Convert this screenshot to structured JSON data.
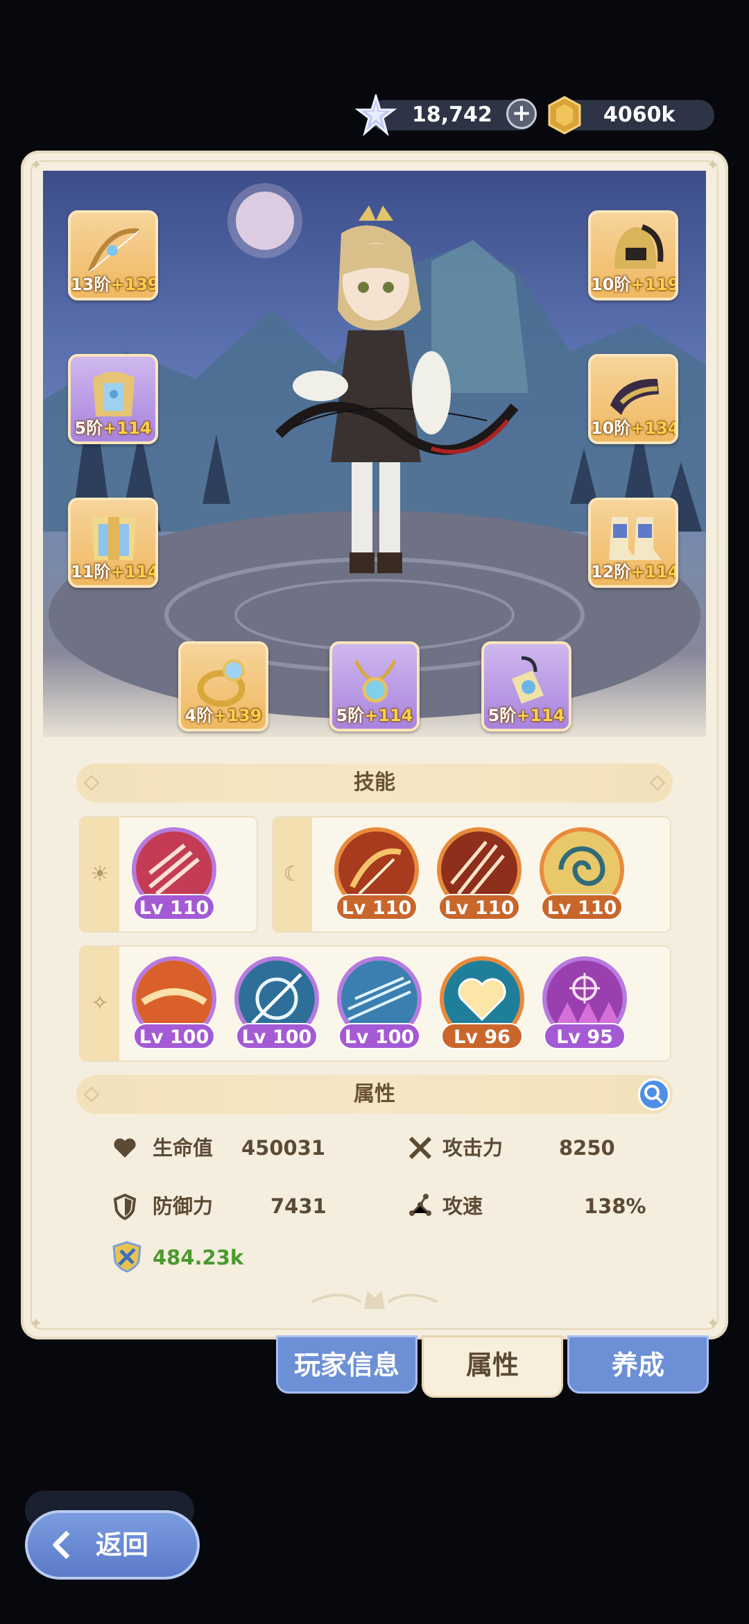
{
  "currency": {
    "gems": "18,742",
    "gold": "4060k"
  },
  "equipment": [
    {
      "slot": "bow",
      "tier": "13阶",
      "bonus": "+139",
      "rarity": "orange"
    },
    {
      "slot": "helmet",
      "tier": "10阶",
      "bonus": "+119",
      "rarity": "orange"
    },
    {
      "slot": "armor",
      "tier": "5阶",
      "bonus": "+114",
      "rarity": "purple"
    },
    {
      "slot": "gloves",
      "tier": "10阶",
      "bonus": "+134",
      "rarity": "orange"
    },
    {
      "slot": "belt",
      "tier": "11阶",
      "bonus": "+114",
      "rarity": "orange"
    },
    {
      "slot": "boots",
      "tier": "12阶",
      "bonus": "+114",
      "rarity": "orange"
    },
    {
      "slot": "ring",
      "tier": "4阶",
      "bonus": "+139",
      "rarity": "orange"
    },
    {
      "slot": "necklace",
      "tier": "5阶",
      "bonus": "+114",
      "rarity": "purple"
    },
    {
      "slot": "amulet",
      "tier": "5阶",
      "bonus": "+114",
      "rarity": "purple"
    }
  ],
  "skills": {
    "title": "技能",
    "day": [
      {
        "level": "Lv 110",
        "rarity": "purple"
      }
    ],
    "night": [
      {
        "level": "Lv 110",
        "rarity": "orange"
      },
      {
        "level": "Lv 110",
        "rarity": "orange"
      },
      {
        "level": "Lv 110",
        "rarity": "orange"
      }
    ],
    "star": [
      {
        "level": "Lv 100",
        "rarity": "purple"
      },
      {
        "level": "Lv 100",
        "rarity": "purple"
      },
      {
        "level": "Lv 100",
        "rarity": "purple"
      },
      {
        "level": "Lv 96",
        "rarity": "orange"
      },
      {
        "level": "Lv 95",
        "rarity": "purple"
      }
    ]
  },
  "attributes": {
    "title": "属性",
    "hp_label": "生命值",
    "hp_value": "450031",
    "atk_label": "攻击力",
    "atk_value": "8250",
    "def_label": "防御力",
    "def_value": "7431",
    "spd_label": "攻速",
    "spd_value": "138%",
    "power_value": "484.23k"
  },
  "tabs": [
    "玩家信息",
    "属性",
    "养成"
  ],
  "back_label": "返回",
  "colors": {
    "panel": "#f5eedf",
    "tab_blue": "#6c8fd6",
    "power_green": "#4a9a2e",
    "purple_rarity": "#a45ad4",
    "orange_rarity": "#c9662b"
  }
}
